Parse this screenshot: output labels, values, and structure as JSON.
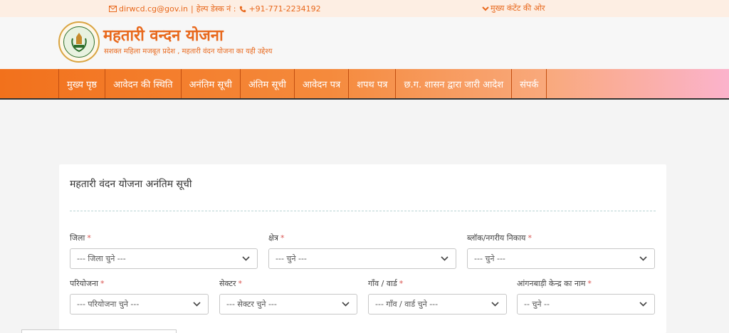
{
  "topbar": {
    "email": "dirwcd.cg@gov.in",
    "helpdesk_label": "हेल्प डेस्क नं :",
    "phone": "+91-771-2234192",
    "skip_link": "मुख्य कंटेंट की ओर",
    "accent": "#e8681c",
    "background": "#fdeee3"
  },
  "header": {
    "title": "महतारी वन्दन योजना",
    "tagline": "सशक्त महिला मजबूत प्रदेश , महतारी वंदन योजना का यही उद्देश्य",
    "logo_icon": "state-emblem-icon"
  },
  "nav": {
    "items": [
      "मुख्य पृष्ठ",
      "आवेदन की स्थिति",
      "अनंतिम सूची",
      "अंतिम सूची",
      "आवेदन पत्र",
      "शपथ पत्र",
      "छ.ग. शासन द्वारा जारी आदेश",
      "संपर्क"
    ],
    "gradient_start": "#f2711c",
    "gradient_end": "#fbb3cc"
  },
  "form": {
    "title": "महतारी वंदन योजना अनंतिम सूची",
    "required_mark": "*",
    "fields": [
      {
        "label": "जिला",
        "placeholder": "--- जिला चुने ---"
      },
      {
        "label": "क्षेत्र",
        "placeholder": "--- चुने ---"
      },
      {
        "label": "ब्लॉक/नगरीय निकाय",
        "placeholder": "--- चुने ---"
      },
      {
        "label": "परियोजना",
        "placeholder": "--- परियोजना चुने ---"
      },
      {
        "label": "सेक्टर",
        "placeholder": "--- सेक्टर चुने ---"
      },
      {
        "label": "गाँव / वार्ड",
        "placeholder": "--- गाँव / वार्ड चुने ---"
      },
      {
        "label": "आंगनबाड़ी केन्द्र का नाम",
        "placeholder": "-- चुने --"
      }
    ]
  }
}
